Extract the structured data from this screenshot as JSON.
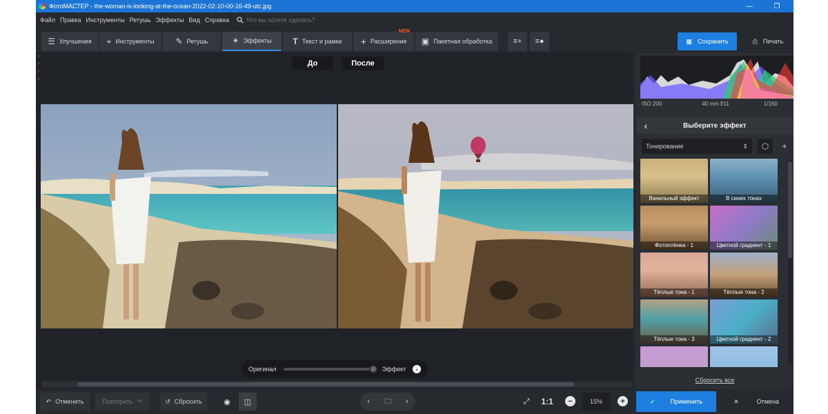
{
  "titlebar": {
    "title": "ФотоМАСТЕР - the-woman-is-looking-at-the-ocean-2022-02-10-00-16-49-utc.jpg",
    "minimize_icon": "minimize-icon",
    "maximize_icon": "restore-icon",
    "close_icon": "close-icon"
  },
  "menu": {
    "items": [
      "Файл",
      "Правка",
      "Инструменты",
      "Ретушь",
      "Эффекты",
      "Вид",
      "Справка"
    ],
    "search_placeholder": "Что вы хотите сделать?"
  },
  "toolbar": {
    "tabs": [
      {
        "label": "Улучшения",
        "icon": "sliders-icon"
      },
      {
        "label": "Инструменты",
        "icon": "crop-icon"
      },
      {
        "label": "Ретушь",
        "icon": "brush-icon"
      },
      {
        "label": "Эффекты",
        "icon": "magic-wand-icon",
        "active": true
      },
      {
        "label": "Текст и рамки",
        "icon": "text-icon"
      },
      {
        "label": "Расширения",
        "icon": "plus-icon",
        "badge": "NEW"
      },
      {
        "label": "Пакетная обработка",
        "icon": "batch-icon"
      }
    ],
    "save_label": "Сохранить",
    "print_label": "Печать"
  },
  "canvas": {
    "before_label": "До",
    "after_label": "После",
    "slider_left": "Оригинал",
    "slider_right": "Эффект",
    "effect_strength": 1.0
  },
  "histogram": {
    "iso": "ISO 200",
    "lens": "40 mm f/11",
    "shutter": "1/160"
  },
  "effects_panel": {
    "header": "Выберите эффект",
    "category": "Тонирование",
    "effects": [
      "Ванильный эффект",
      "В синих тонах",
      "Фотоплёнка - 1",
      "Цветной градиент - 1",
      "Тёплые тона - 1",
      "Тёплые тона - 2",
      "Тёплые тона - 3",
      "Цветной градиент - 2"
    ],
    "reset_all": "Сбросить все"
  },
  "bottombar": {
    "undo": "Отменить",
    "redo": "Повторить",
    "reset": "Сбросить",
    "ratio": "1:1",
    "zoom": "15%",
    "apply": "Применить",
    "cancel": "Отмена"
  },
  "colors": {
    "accent": "#1d7fe0",
    "titlebar": "#1c74d6",
    "bg": "#26292e",
    "new_badge": "#ff5a1f"
  }
}
